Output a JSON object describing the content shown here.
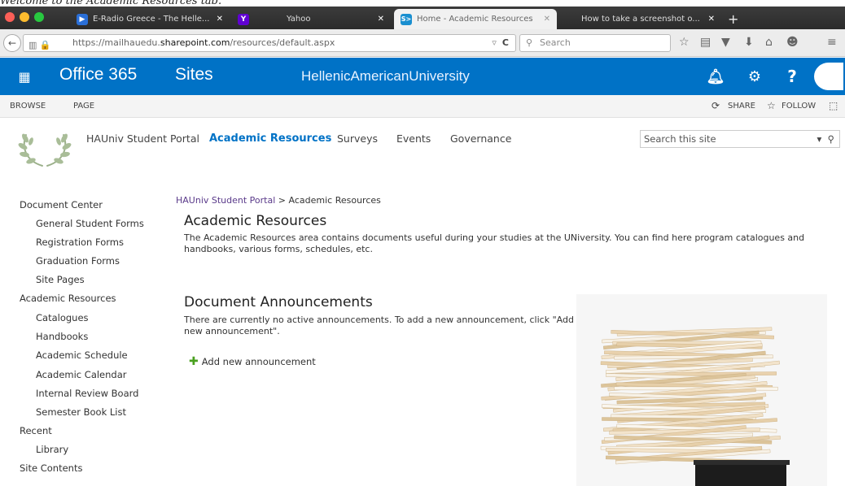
{
  "caption": "Welcome to the Academic Resources tab.",
  "browser": {
    "tabs": [
      {
        "label": "E-Radio Greece - The Helle...",
        "fav": "▶",
        "color": "#2a6fd8"
      },
      {
        "label": "Yahoo",
        "fav": "Y",
        "color": "#6001d2"
      },
      {
        "label": "Home - Academic Resources",
        "fav": "S>",
        "color": "#1a8fd0"
      },
      {
        "label": "How to take a screenshot o...",
        "fav": "",
        "color": "#888"
      }
    ],
    "url_pre": "https://mailhauedu.",
    "url_dom": "sharepoint.com",
    "url_post": "/resources/default.aspx",
    "search_placeholder": "Search"
  },
  "suite": {
    "app": "Office 365",
    "section": "Sites",
    "org": "HellenicAmericanUniversity",
    "help": "?"
  },
  "ribbon": {
    "browse": "BROWSE",
    "page": "PAGE",
    "share": "SHARE",
    "follow": "FOLLOW"
  },
  "topnav": [
    "HAUniv Student Portal",
    "Academic Resources",
    "Surveys",
    "Events",
    "Governance"
  ],
  "site_search": "Search this site",
  "leftnav": [
    {
      "label": "Document Center",
      "level": 0
    },
    {
      "label": "General Student Forms",
      "level": 1
    },
    {
      "label": "Registration Forms",
      "level": 1
    },
    {
      "label": "Graduation Forms",
      "level": 1
    },
    {
      "label": "Site Pages",
      "level": 1
    },
    {
      "label": "Academic Resources",
      "level": 0
    },
    {
      "label": "Catalogues",
      "level": 1
    },
    {
      "label": "Handbooks",
      "level": 1
    },
    {
      "label": "Academic Schedule",
      "level": 1
    },
    {
      "label": "Academic Calendar",
      "level": 1
    },
    {
      "label": "Internal Review Board",
      "level": 1
    },
    {
      "label": "Semester Book List",
      "level": 1
    },
    {
      "label": "Recent",
      "level": 0
    },
    {
      "label": "Library",
      "level": 1
    },
    {
      "label": "Site Contents",
      "level": 0
    }
  ],
  "main": {
    "crumb_link": "HAUniv Student Portal",
    "crumb_sep": " > ",
    "crumb_current": "Academic Resources",
    "title": "Academic Resources",
    "description": "The Academic Resources area contains documents useful during your studies at the UNiversity. You can find here program catalogues and handbooks, various forms, schedules, etc.",
    "ann_title": "Document Announcements",
    "ann_empty": "There are currently no active announcements. To add a new announcement, click \"Add new announcement\".",
    "add_label": "Add new announcement"
  }
}
